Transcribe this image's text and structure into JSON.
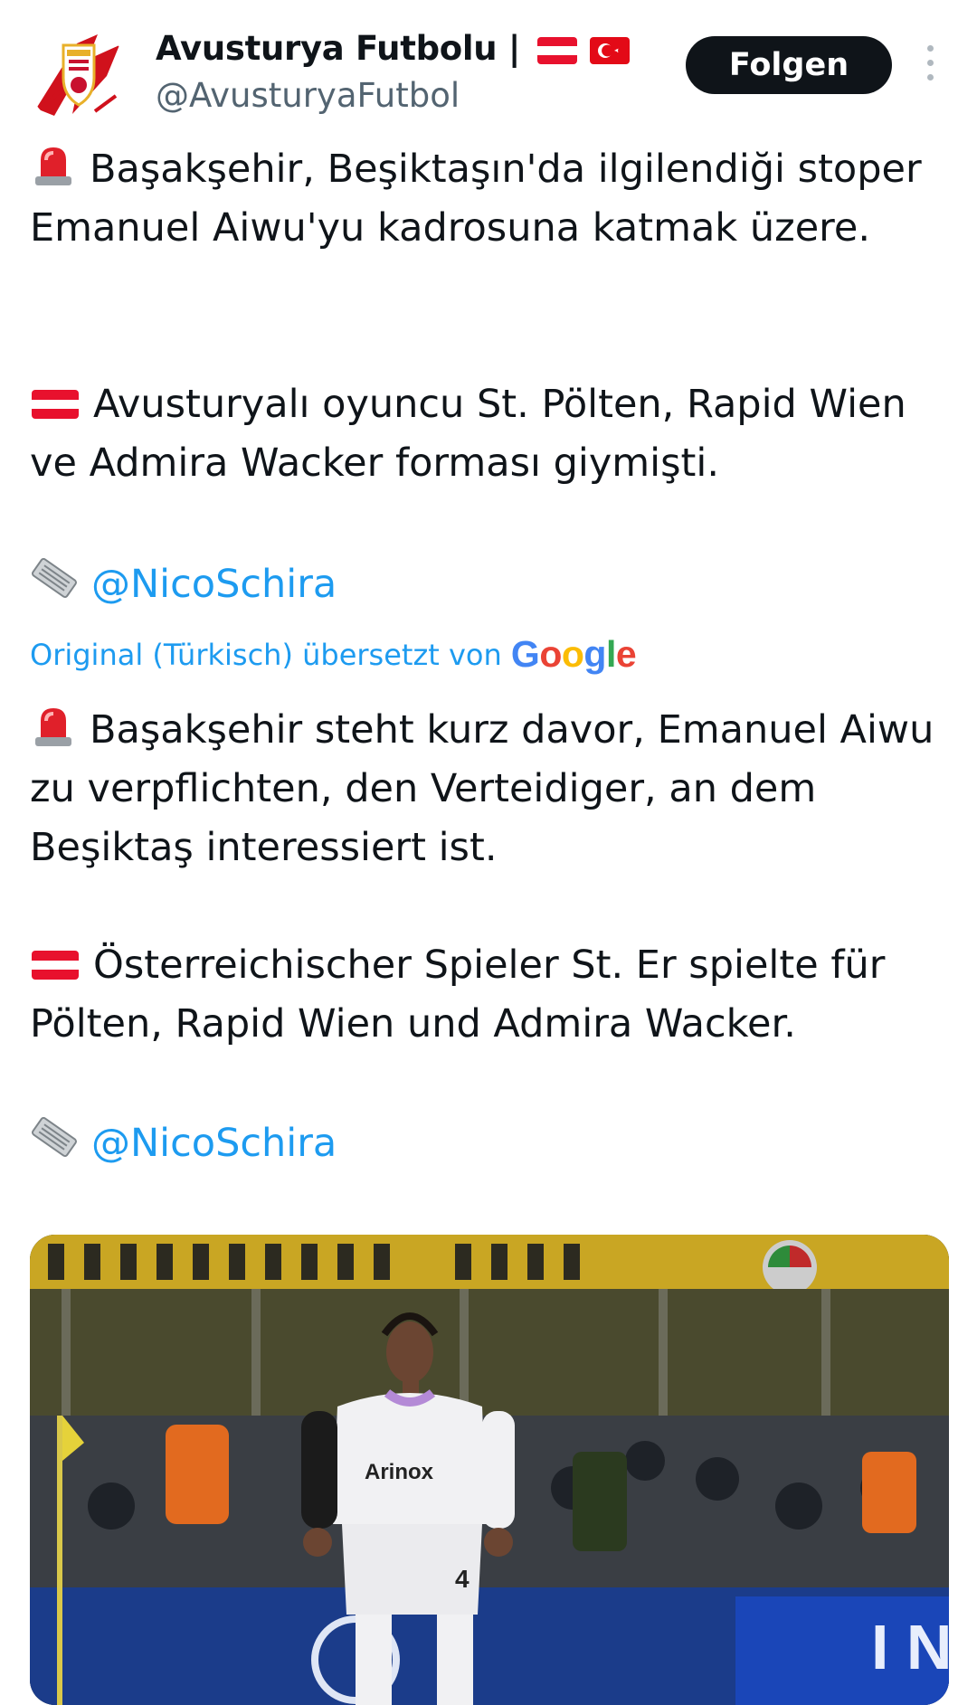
{
  "header": {
    "display_name": "Avusturya Futbolu |",
    "handle": "@AvusturyaFutbol",
    "follow_label": "Folgen",
    "avatar_icon": "bundesliga-logo-icon",
    "flags": [
      "austria-flag-icon",
      "turkey-flag-icon"
    ]
  },
  "tweet": {
    "original": {
      "line1": "Başakşehir, Beşiktaşın'da ilgilendiği stoper Emanuel Aiwu'yu kadrosuna katmak üzere.",
      "line2": "Avusturyalı oyuncu St. Pölten, Rapid Wien ve Admira Wacker forması giymişti.",
      "source": "@NicoSchira"
    },
    "translation_note": "Original (Türkisch) übersetzt von",
    "translation_provider": "Google",
    "translated": {
      "line1": "Başakşehir steht kurz davor, Emanuel Aiwu zu verpflichten, den Verteidiger, an dem Beşiktaş interessiert ist.",
      "line2": "Österreichischer Spieler St. Er spielte für Pölten, Rapid Wien und Admira Wacker.",
      "source": "@NicoSchira"
    }
  },
  "media": {
    "shirt_number": "4",
    "sponsor_text": "Arinox"
  },
  "colors": {
    "link": "#1d9bf0",
    "text": "#0f1419",
    "secondary": "#536471",
    "button": "#0f1419"
  }
}
